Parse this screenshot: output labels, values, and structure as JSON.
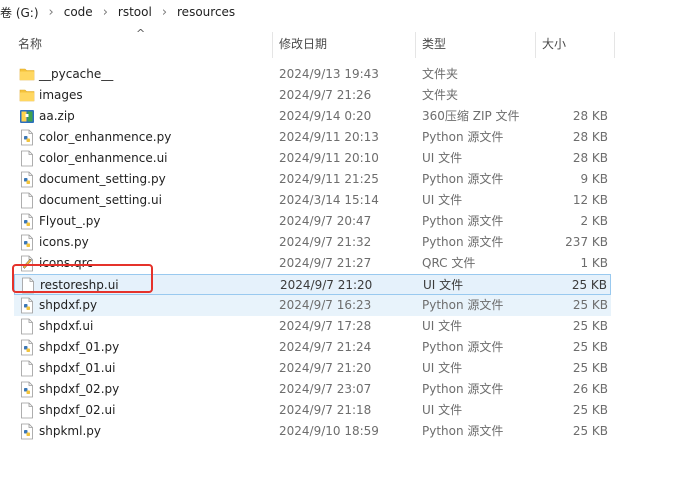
{
  "breadcrumb": [
    "卷 (G:)",
    "code",
    "rstool",
    "resources"
  ],
  "columns": {
    "name": "名称",
    "date": "修改日期",
    "type": "类型",
    "size": "大小"
  },
  "files": [
    {
      "name": "__pycache__",
      "date": "2024/9/13 19:43",
      "type": "文件夹",
      "size": "",
      "icon": "folder-icon"
    },
    {
      "name": "images",
      "date": "2024/9/7 21:26",
      "type": "文件夹",
      "size": "",
      "icon": "folder-icon"
    },
    {
      "name": "aa.zip",
      "date": "2024/9/14 0:20",
      "type": "360压缩 ZIP 文件",
      "size": "28 KB",
      "icon": "zip-archive-icon"
    },
    {
      "name": "color_enhanmence.py",
      "date": "2024/9/11 20:13",
      "type": "Python 源文件",
      "size": "28 KB",
      "icon": "python-file-icon"
    },
    {
      "name": "color_enhanmence.ui",
      "date": "2024/9/11 20:10",
      "type": "UI 文件",
      "size": "28 KB",
      "icon": "blank-file-icon"
    },
    {
      "name": "document_setting.py",
      "date": "2024/9/11 21:25",
      "type": "Python 源文件",
      "size": "9 KB",
      "icon": "python-file-icon"
    },
    {
      "name": "document_setting.ui",
      "date": "2024/3/14 15:14",
      "type": "UI 文件",
      "size": "12 KB",
      "icon": "blank-file-icon"
    },
    {
      "name": "Flyout_.py",
      "date": "2024/9/7 20:47",
      "type": "Python 源文件",
      "size": "2 KB",
      "icon": "python-file-icon"
    },
    {
      "name": "icons.py",
      "date": "2024/9/7 21:32",
      "type": "Python 源文件",
      "size": "237 KB",
      "icon": "python-file-icon"
    },
    {
      "name": "icons.qrc",
      "date": "2024/9/7 21:27",
      "type": "QRC 文件",
      "size": "1 KB",
      "icon": "qrc-file-icon"
    },
    {
      "name": "restoreshp.ui",
      "date": "2024/9/7 21:20",
      "type": "UI 文件",
      "size": "25 KB",
      "icon": "blank-file-icon",
      "selected": true
    },
    {
      "name": "shpdxf.py",
      "date": "2024/9/7 16:23",
      "type": "Python 源文件",
      "size": "25 KB",
      "icon": "python-file-icon",
      "hover": true
    },
    {
      "name": "shpdxf.ui",
      "date": "2024/9/7 17:28",
      "type": "UI 文件",
      "size": "25 KB",
      "icon": "blank-file-icon"
    },
    {
      "name": "shpdxf_01.py",
      "date": "2024/9/7 21:24",
      "type": "Python 源文件",
      "size": "25 KB",
      "icon": "python-file-icon"
    },
    {
      "name": "shpdxf_01.ui",
      "date": "2024/9/7 21:20",
      "type": "UI 文件",
      "size": "25 KB",
      "icon": "blank-file-icon"
    },
    {
      "name": "shpdxf_02.py",
      "date": "2024/9/7 23:07",
      "type": "Python 源文件",
      "size": "26 KB",
      "icon": "python-file-icon"
    },
    {
      "name": "shpdxf_02.ui",
      "date": "2024/9/7 21:18",
      "type": "UI 文件",
      "size": "25 KB",
      "icon": "blank-file-icon"
    },
    {
      "name": "shpkml.py",
      "date": "2024/9/10 18:59",
      "type": "Python 源文件",
      "size": "25 KB",
      "icon": "python-file-icon"
    }
  ],
  "colors": {
    "selection_bg": "#e5f1fb",
    "selection_border": "#99c9ef",
    "hover_bg": "#e8f3fb",
    "highlight_box": "#e5322b",
    "folder": "#f5c33b",
    "python_blue": "#3b77b6"
  }
}
